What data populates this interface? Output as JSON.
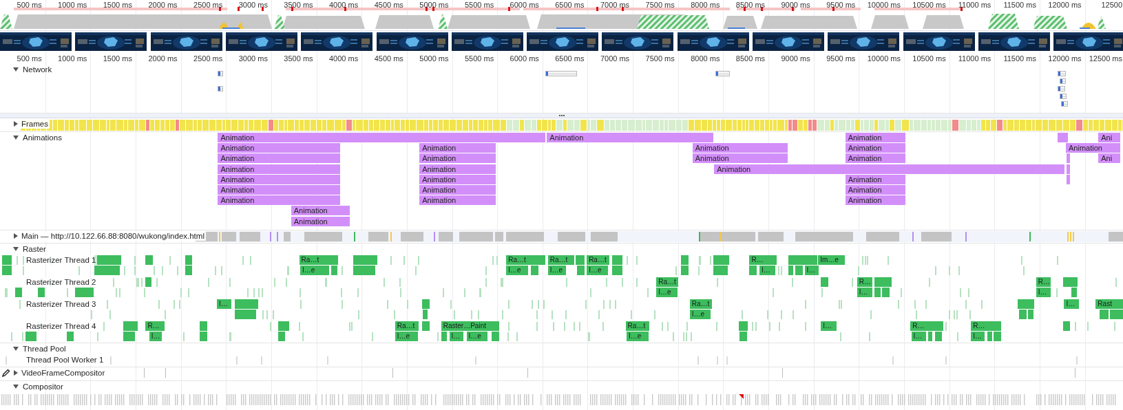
{
  "overview": {
    "ticks": [
      "500 ms",
      "1000 ms",
      "1500 ms",
      "2000 ms",
      "2500 ms",
      "3000 ms",
      "3500 ms",
      "4000 ms",
      "4500 ms",
      "5000 ms",
      "5500 ms",
      "6000 ms",
      "6500 ms",
      "7000 ms",
      "7500 ms",
      "8000 ms",
      "8500 ms",
      "9000 ms",
      "9500 ms",
      "10000 ms",
      "10500 ms",
      "11000 ms",
      "11500 ms",
      "12000 ms",
      "12500"
    ]
  },
  "ruler": {
    "ticks": [
      "500 ms",
      "1000 ms",
      "1500 ms",
      "2000 ms",
      "2500 ms",
      "3000 ms",
      "3500 ms",
      "4000 ms",
      "4500 ms",
      "5000 ms",
      "5500 ms",
      "6000 ms",
      "6500 ms",
      "7000 ms",
      "7500 ms",
      "8000 ms",
      "8500 ms",
      "9000 ms",
      "9500 ms",
      "10000 ms",
      "10500 ms",
      "11000 ms",
      "11500 ms",
      "12000 ms",
      "12500 ms"
    ]
  },
  "tracks": [
    {
      "kind": "network",
      "title": "Network",
      "expanded": true
    },
    {
      "kind": "frames",
      "title": "Frames",
      "expanded": false
    },
    {
      "kind": "animations",
      "title": "Animations",
      "expanded": true,
      "bars": [
        {
          "label": "Animation"
        },
        {
          "label": "Animation"
        },
        {
          "label": "Animation"
        },
        {
          "label": "Ani"
        },
        {
          "label": "Animation"
        },
        {
          "label": "Animation"
        },
        {
          "label": "Animation"
        },
        {
          "label": "Animation"
        },
        {
          "label": "Animation"
        },
        {
          "label": "Animation"
        },
        {
          "label": "Animation"
        },
        {
          "label": "Animation"
        },
        {
          "label": "Animation"
        },
        {
          "label": "Ani"
        },
        {
          "label": "Animation"
        },
        {
          "label": "Animation"
        },
        {
          "label": "Animation"
        },
        {
          "label": "Animation"
        },
        {
          "label": "Animation"
        },
        {
          "label": "Animation"
        },
        {
          "label": "Animation"
        },
        {
          "label": "Animation"
        },
        {
          "label": "Animation"
        },
        {
          "label": "Animation"
        },
        {
          "label": "Animation"
        },
        {
          "label": "Animation"
        },
        {
          "label": "Animation"
        },
        {
          "label": "Animation"
        }
      ]
    },
    {
      "kind": "main",
      "title": "Main — http://10.122.66.88:8080/wukong/index.html",
      "expanded": false
    },
    {
      "kind": "group",
      "title": "Raster",
      "expanded": true,
      "threads": [
        {
          "name": "Rasterizer Thread 1",
          "tasks": [
            {
              "label": "Ra…t"
            },
            {
              "label": "Ra…t"
            },
            {
              "label": "Ra…t"
            },
            {
              "label": "Ra…t"
            },
            {
              "label": "R…"
            },
            {
              "label": "Im…e"
            },
            {
              "label": "I…e"
            },
            {
              "label": "I…e"
            },
            {
              "label": "I…e"
            },
            {
              "label": "I…e"
            },
            {
              "label": "I…"
            },
            {
              "label": "I…"
            }
          ]
        },
        {
          "name": "Rasterizer Thread 2",
          "tasks": [
            {
              "label": "Ra…t"
            },
            {
              "label": "R…"
            },
            {
              "label": "R…"
            },
            {
              "label": "I…e"
            },
            {
              "label": "I…"
            },
            {
              "label": "I…"
            }
          ]
        },
        {
          "name": "Rasterizer Thread 3",
          "tasks": [
            {
              "label": "I…"
            },
            {
              "label": "Ra…t"
            },
            {
              "label": "I…"
            },
            {
              "label": "Rast"
            },
            {
              "label": "I…e"
            }
          ]
        },
        {
          "name": "Rasterizer Thread 4",
          "tasks": [
            {
              "label": "R…"
            },
            {
              "label": "Ra…t"
            },
            {
              "label": "Raster…Paint"
            },
            {
              "label": "Ra…t"
            },
            {
              "label": "I…"
            },
            {
              "label": "R…"
            },
            {
              "label": "R…"
            },
            {
              "label": "I…"
            },
            {
              "label": "I…e"
            },
            {
              "label": "I…"
            },
            {
              "label": "I…e"
            },
            {
              "label": "I…e"
            },
            {
              "label": "I…"
            },
            {
              "label": "I…"
            }
          ]
        }
      ]
    },
    {
      "kind": "group",
      "title": "Thread Pool",
      "expanded": true,
      "threads": [
        {
          "name": "Thread Pool Worker 1"
        }
      ]
    },
    {
      "kind": "video",
      "title": "VideoFrameCompositor",
      "expanded": false
    },
    {
      "kind": "compositor",
      "title": "Compositor",
      "expanded": true
    }
  ]
}
